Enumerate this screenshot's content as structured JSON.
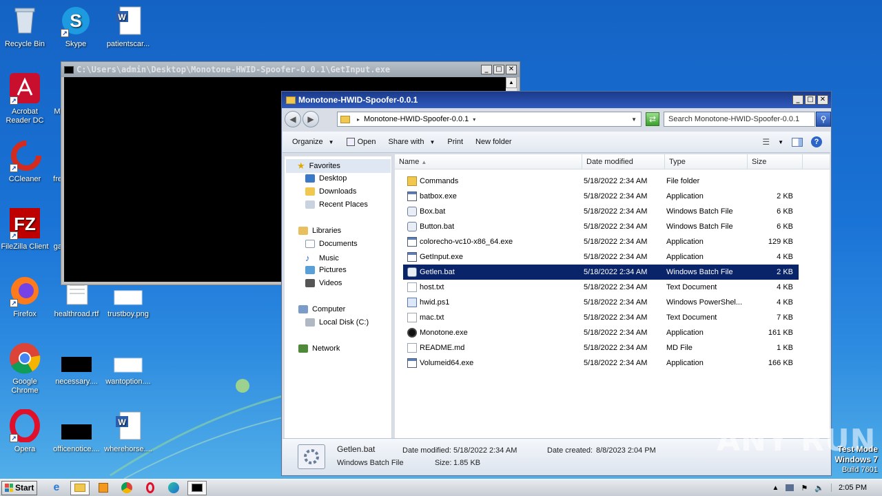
{
  "desktop": {
    "icons": [
      {
        "label": "Recycle Bin",
        "icon": "recycle-bin-icon"
      },
      {
        "label": "Skype",
        "icon": "skype-icon"
      },
      {
        "label": "patientscar...",
        "icon": "word-doc-icon"
      },
      {
        "label": "Acrobat Reader DC",
        "icon": "acrobat-icon"
      },
      {
        "label": "Mi",
        "icon": "partial-icon"
      },
      {
        "label": "CCleaner",
        "icon": "ccleaner-icon"
      },
      {
        "label": "fre",
        "icon": "partial-icon"
      },
      {
        "label": "FileZilla Client",
        "icon": "filezilla-icon"
      },
      {
        "label": "ga",
        "icon": "partial-icon"
      },
      {
        "label": "Firefox",
        "icon": "firefox-icon"
      },
      {
        "label": "healthroad.rtf",
        "icon": "rtf-doc-icon"
      },
      {
        "label": "trustboy.png",
        "icon": "png-file-icon"
      },
      {
        "label": "Google Chrome",
        "icon": "chrome-icon"
      },
      {
        "label": "necessary....",
        "icon": "black-file-icon"
      },
      {
        "label": "wantoption....",
        "icon": "blank-file-icon"
      },
      {
        "label": "Opera",
        "icon": "opera-icon"
      },
      {
        "label": "officenotice....",
        "icon": "black-file-icon"
      },
      {
        "label": "wherehorse....",
        "icon": "word-doc-icon"
      }
    ]
  },
  "console": {
    "title": "C:\\Users\\admin\\Desktop\\Monotone-HWID-Spoofer-0.0.1\\GetInput.exe"
  },
  "explorer": {
    "title": "Monotone-HWID-Spoofer-0.0.1",
    "address": "Monotone-HWID-Spoofer-0.0.1",
    "search_placeholder": "Search Monotone-HWID-Spoofer-0.0.1",
    "toolbar": {
      "organize": "Organize",
      "open": "Open",
      "share_with": "Share with",
      "print": "Print",
      "new_folder": "New folder"
    },
    "nav": {
      "favorites": "Favorites",
      "desktop": "Desktop",
      "downloads": "Downloads",
      "recent_places": "Recent Places",
      "libraries": "Libraries",
      "documents": "Documents",
      "music": "Music",
      "pictures": "Pictures",
      "videos": "Videos",
      "computer": "Computer",
      "local_disk": "Local Disk (C:)",
      "network": "Network"
    },
    "columns": {
      "name": "Name",
      "date_modified": "Date modified",
      "type": "Type",
      "size": "Size"
    },
    "files": [
      {
        "name": "Commands",
        "date": "5/18/2022 2:34 AM",
        "type": "File folder",
        "size": "",
        "icon": "folder"
      },
      {
        "name": "batbox.exe",
        "date": "5/18/2022 2:34 AM",
        "type": "Application",
        "size": "2 KB",
        "icon": "app"
      },
      {
        "name": "Box.bat",
        "date": "5/18/2022 2:34 AM",
        "type": "Windows Batch File",
        "size": "6 KB",
        "icon": "bat"
      },
      {
        "name": "Button.bat",
        "date": "5/18/2022 2:34 AM",
        "type": "Windows Batch File",
        "size": "6 KB",
        "icon": "bat"
      },
      {
        "name": "colorecho-vc10-x86_64.exe",
        "date": "5/18/2022 2:34 AM",
        "type": "Application",
        "size": "129 KB",
        "icon": "app"
      },
      {
        "name": "GetInput.exe",
        "date": "5/18/2022 2:34 AM",
        "type": "Application",
        "size": "4 KB",
        "icon": "app"
      },
      {
        "name": "Getlen.bat",
        "date": "5/18/2022 2:34 AM",
        "type": "Windows Batch File",
        "size": "2 KB",
        "icon": "bat",
        "selected": true
      },
      {
        "name": "host.txt",
        "date": "5/18/2022 2:34 AM",
        "type": "Text Document",
        "size": "4 KB",
        "icon": "txt"
      },
      {
        "name": "hwid.ps1",
        "date": "5/18/2022 2:34 AM",
        "type": "Windows PowerShel...",
        "size": "4 KB",
        "icon": "ps"
      },
      {
        "name": "mac.txt",
        "date": "5/18/2022 2:34 AM",
        "type": "Text Document",
        "size": "7 KB",
        "icon": "txt"
      },
      {
        "name": "Monotone.exe",
        "date": "5/18/2022 2:34 AM",
        "type": "Application",
        "size": "161 KB",
        "icon": "mono"
      },
      {
        "name": "README.md",
        "date": "5/18/2022 2:34 AM",
        "type": "MD File",
        "size": "1 KB",
        "icon": "txt"
      },
      {
        "name": "Volumeid64.exe",
        "date": "5/18/2022 2:34 AM",
        "type": "Application",
        "size": "166 KB",
        "icon": "app"
      }
    ],
    "details": {
      "name": "Getlen.bat",
      "type": "Windows Batch File",
      "date_modified_label": "Date modified:",
      "date_modified": "5/18/2022 2:34 AM",
      "date_created_label": "Date created:",
      "date_created": "8/8/2023 2:04 PM",
      "size_label": "Size:",
      "size": "1.85 KB"
    }
  },
  "taskbar": {
    "start": "Start",
    "clock": "2:05 PM"
  },
  "watermark": {
    "line1": "Test Mode",
    "line2": "Windows 7",
    "line3": "Build 7601",
    "anyrun": "ANY RUN"
  }
}
